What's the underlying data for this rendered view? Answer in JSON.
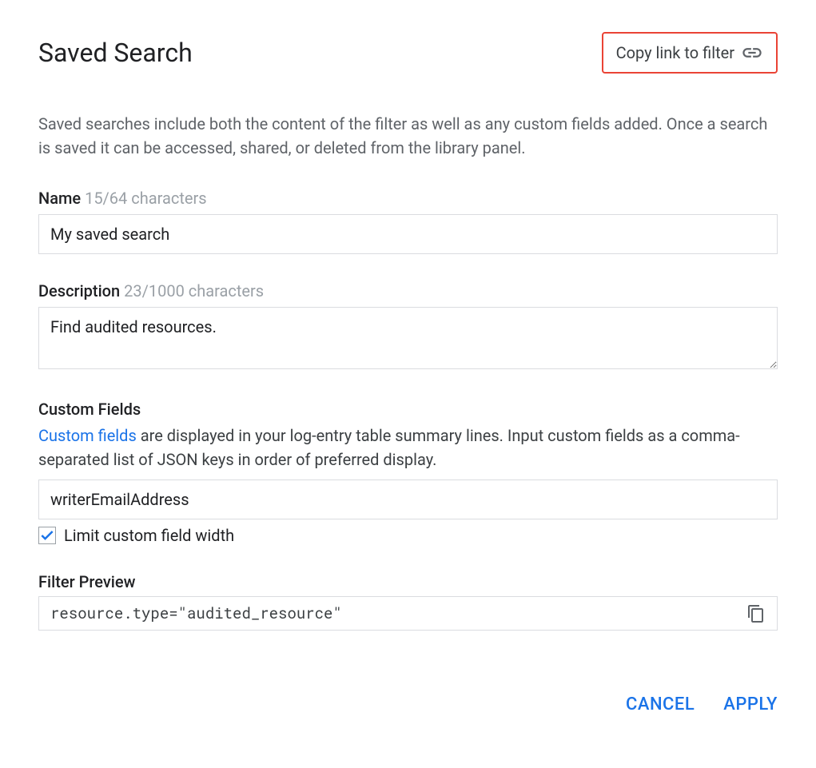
{
  "header": {
    "title": "Saved Search",
    "copy_link_label": "Copy link to filter"
  },
  "intro": "Saved searches include both the content of the filter as well as any custom fields added. Once a search is saved it can be accessed, shared, or deleted from the library panel.",
  "name_field": {
    "label": "Name",
    "char_count": "15/64 characters",
    "value": "My saved search"
  },
  "description_field": {
    "label": "Description",
    "char_count": "23/1000 characters",
    "value": "Find audited resources."
  },
  "custom_fields": {
    "label": "Custom Fields",
    "link_text": "Custom fields",
    "desc_rest": " are displayed in your log-entry table summary lines. Input custom fields as a comma-separated list of JSON keys in order of preferred display.",
    "value": "writerEmailAddress",
    "checkbox_label": "Limit custom field width",
    "checkbox_checked": true
  },
  "filter_preview": {
    "label": "Filter Preview",
    "code": "resource.type=\"audited_resource\""
  },
  "footer": {
    "cancel": "CANCEL",
    "apply": "APPLY"
  }
}
